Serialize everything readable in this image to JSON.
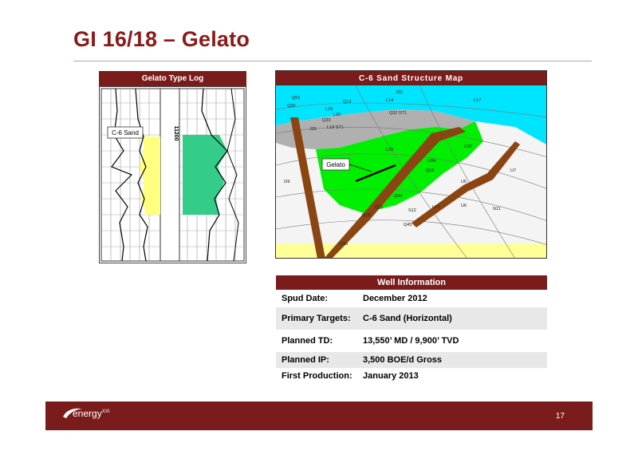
{
  "slide": {
    "title": "GI 16/18 – Gelato",
    "page_number": "17"
  },
  "type_log": {
    "header": "Gelato Type Log",
    "sand_label": "C-6 Sand",
    "depth_label": "11200"
  },
  "structure_map": {
    "header": "C-6 Sand Structure Map",
    "well_callout": "Gelato",
    "well_labels": [
      "Q51",
      "Q30",
      "Q13",
      "L28",
      "L20",
      "Q33",
      "J29",
      "L14",
      "J32",
      "L17",
      "Q32 ST1",
      "L18 ST1",
      "Q16",
      "U34",
      "C42",
      "U7",
      "U5",
      "Q44",
      "Q12",
      "S12",
      "U6",
      "N11",
      "U27",
      "Q45",
      "Q18",
      "U19",
      "I36",
      "L25"
    ]
  },
  "well_info": {
    "header": "Well Information",
    "rows": [
      {
        "label": "Spud Date:",
        "value": "December 2012"
      },
      {
        "label": "Primary Targets:",
        "value": "C-6 Sand (Horizontal)"
      },
      {
        "label": "Planned TD:",
        "value": "13,550’ MD / 9,900’ TVD"
      },
      {
        "label": "Planned IP:",
        "value": "3,500 BOE/d Gross"
      },
      {
        "label": "First Production:",
        "value": "January 2013"
      }
    ]
  },
  "footer": {
    "logo_text": "energy",
    "logo_suffix": "XXI"
  },
  "colors": {
    "brand": "#7a1c1c",
    "title": "#8b1a1a",
    "map_water": "#00e5ff",
    "map_sand": "#00ee00",
    "map_gray": "#b0b0b0",
    "map_yellow": "#ffff99",
    "fault": "#8b4513",
    "log_yellow": "#ffff80",
    "log_green": "#33cc88"
  }
}
